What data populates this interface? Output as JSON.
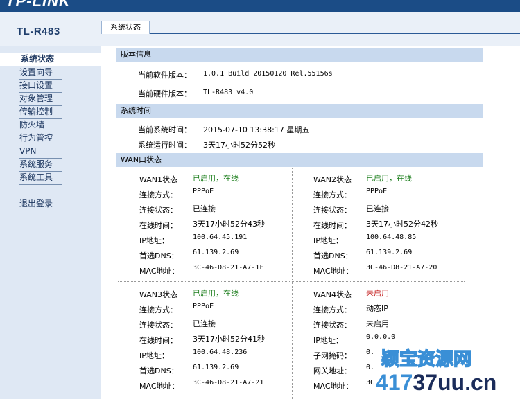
{
  "header": {
    "logo": "TP-LINK",
    "model": "TL-R483",
    "tab": "系统状态"
  },
  "sidebar": {
    "items": [
      "系统状态",
      "设置向导",
      "接口设置",
      "对象管理",
      "传输控制",
      "防火墙",
      "行为管控",
      "VPN",
      "系统服务",
      "系统工具"
    ],
    "logout": "退出登录"
  },
  "version": {
    "title": "版本信息",
    "software_label": "当前软件版本：",
    "software_value": "1.0.1 Build 20150120 Rel.55156s",
    "hardware_label": "当前硬件版本：",
    "hardware_value": "TL-R483 v4.0"
  },
  "time": {
    "title": "系统时间",
    "current_label": "当前系统时间：",
    "current_value": "2015-07-10 13:38:17 星期五",
    "uptime_label": "系统运行时间：",
    "uptime_value": "3天17小时52分52秒"
  },
  "wan": {
    "title": "WAN口状态",
    "ports": [
      {
        "rows": [
          [
            "WAN1状态",
            "已启用，在线"
          ],
          [
            "连接方式：",
            "PPPoE"
          ],
          [
            "连接状态：",
            "已连接"
          ],
          [
            "在线时间：",
            "3天17小时52分43秒"
          ],
          [
            "IP地址：",
            "100.64.45.191"
          ],
          [
            "首选DNS：",
            "61.139.2.69"
          ],
          [
            "MAC地址：",
            "3C-46-D8-21-A7-1F"
          ]
        ]
      },
      {
        "rows": [
          [
            "WAN2状态",
            "已启用，在线"
          ],
          [
            "连接方式：",
            "PPPoE"
          ],
          [
            "连接状态：",
            "已连接"
          ],
          [
            "在线时间：",
            "3天17小时52分42秒"
          ],
          [
            "IP地址：",
            "100.64.48.85"
          ],
          [
            "首选DNS：",
            "61.139.2.69"
          ],
          [
            "MAC地址：",
            "3C-46-D8-21-A7-20"
          ]
        ]
      },
      {
        "rows": [
          [
            "WAN3状态",
            "已启用，在线"
          ],
          [
            "连接方式：",
            "PPPoE"
          ],
          [
            "连接状态：",
            "已连接"
          ],
          [
            "在线时间：",
            "3天17小时52分41秒"
          ],
          [
            "IP地址：",
            "100.64.48.236"
          ],
          [
            "首选DNS：",
            "61.139.2.69"
          ],
          [
            "MAC地址：",
            "3C-46-D8-21-A7-21"
          ]
        ]
      },
      {
        "rows": [
          [
            "WAN4状态",
            "未启用"
          ],
          [
            "连接方式：",
            "动态IP"
          ],
          [
            "连接状态：",
            "未启用"
          ],
          [
            "IP地址：",
            "0.0.0.0"
          ],
          [
            "子网掩码：",
            "0."
          ],
          [
            "网关地址：",
            "0."
          ],
          [
            "MAC地址：",
            "3C"
          ]
        ]
      }
    ]
  },
  "watermark": {
    "line1": "颖宝资源网",
    "line2a": "417",
    "line2b": "37uu.cn"
  },
  "colors": {
    "header": "#1b4c86",
    "section": "#c8d9ee",
    "sidebar": "#dfe8f4",
    "enabled": "#1a7d1a",
    "disabled": "#c21818"
  }
}
